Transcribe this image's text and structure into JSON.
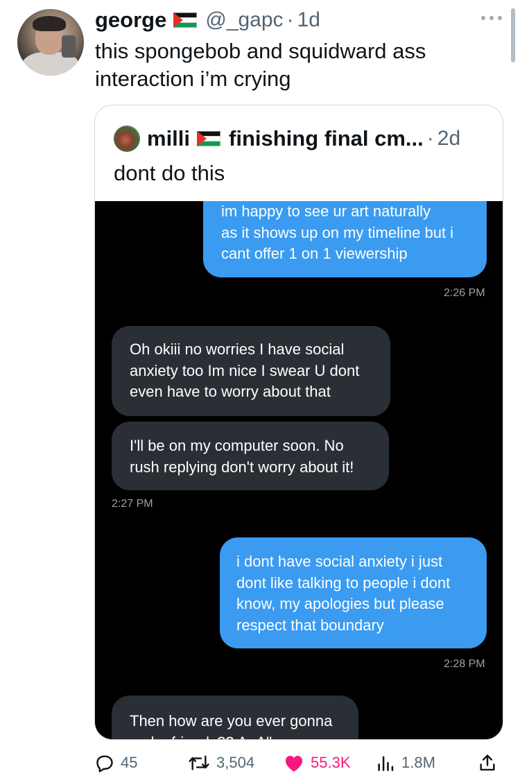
{
  "tweet": {
    "author_name": "george",
    "handle": "@_gapc",
    "separator": "·",
    "age": "1d",
    "text_line1": "this spongebob and squidward ass",
    "text_line2": "interaction i’m crying"
  },
  "quote": {
    "author_name": "milli",
    "display_name_rest": "finishing final cm...",
    "separator": "·",
    "age": "2d",
    "text": "dont do this"
  },
  "chat": {
    "messages": [
      {
        "dir": "out",
        "lines": [
          "im happy to see ur art naturally",
          "as it shows up on my timeline but i",
          "cant offer 1 on 1 viewership"
        ]
      },
      {
        "dir": "in",
        "lines": [
          "Oh okiii no worries I have social",
          "anxiety too Im nice I swear U dont",
          "even have to worry about that"
        ]
      },
      {
        "dir": "in",
        "lines": [
          "I'll be on my computer soon. No",
          "rush replying don't worry about it!"
        ]
      },
      {
        "dir": "out",
        "lines": [
          "i dont have social anxiety i just",
          "dont like talking to people i dont",
          "know, my apologies but please",
          "respect that boundary"
        ]
      },
      {
        "dir": "in",
        "lines": [
          "Then how are you ever gonna",
          "make friends?? A_A''"
        ]
      }
    ],
    "timestamps": [
      "2:26 PM",
      "2:27 PM",
      "2:28 PM"
    ]
  },
  "actions": {
    "replies": "45",
    "retweets": "3,504",
    "likes": "55.3K",
    "views": "1.8M"
  },
  "colors": {
    "outgoing_bubble": "#3a9bf0",
    "incoming_bubble": "#2a2f35",
    "like_pink": "#f91880",
    "muted_text": "#536471"
  },
  "icons": [
    "more-icon",
    "reply-icon",
    "retweet-icon",
    "heart-icon",
    "views-icon",
    "share-icon"
  ]
}
